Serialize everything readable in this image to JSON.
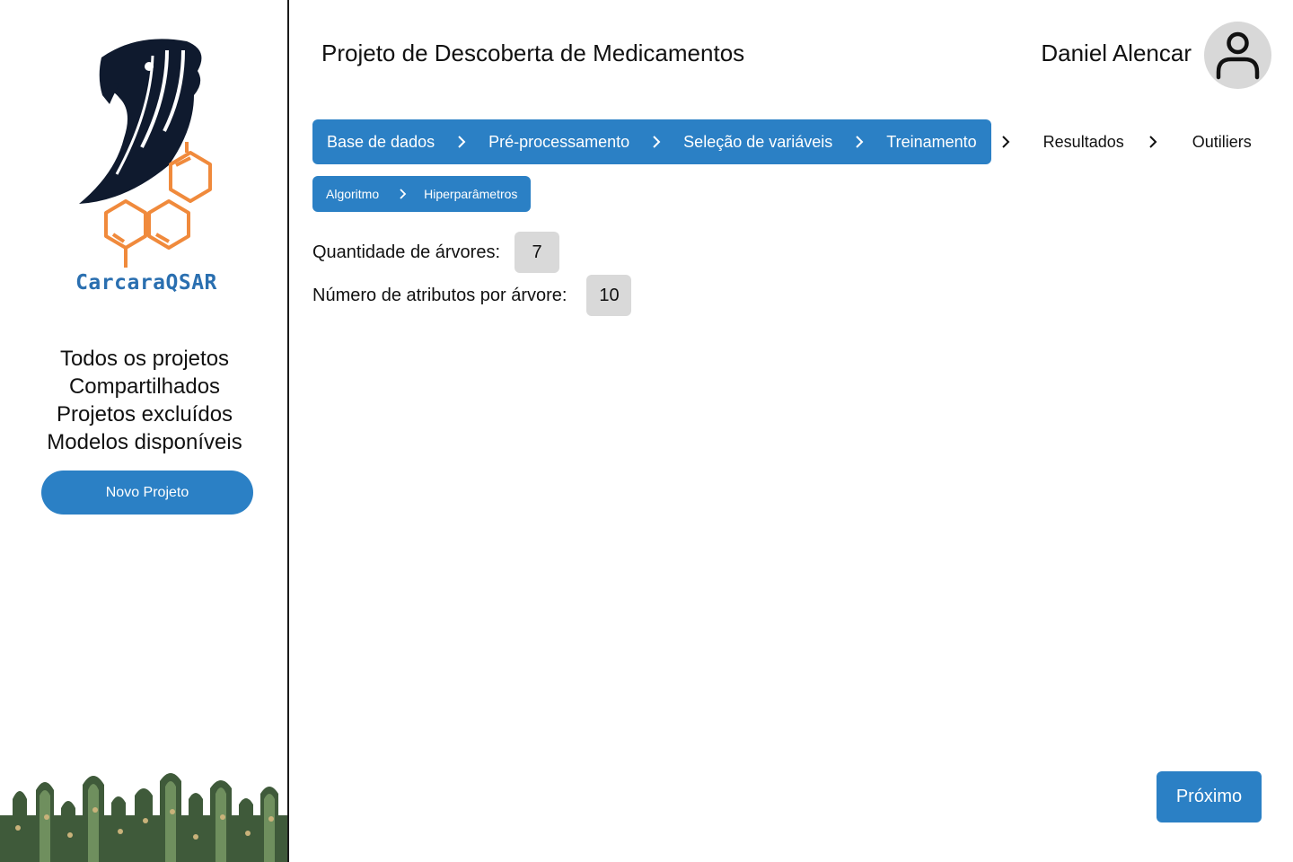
{
  "app": {
    "logo_text": "CarcaraQSAR",
    "colors": {
      "accent": "#2b80c5",
      "logo_orange": "#f08a3c",
      "logo_navy": "#0f1a2e",
      "logo_text": "#2a6fb0",
      "chip_bg": "#d9d9d9",
      "avatar_bg": "#d8d8d8"
    }
  },
  "sidebar": {
    "items": [
      {
        "label": "Todos os projetos"
      },
      {
        "label": "Compartilhados"
      },
      {
        "label": "Projetos excluídos"
      },
      {
        "label": "Modelos disponíveis"
      }
    ],
    "new_project_label": "Novo Projeto"
  },
  "header": {
    "title": "Projeto de Descoberta de Medicamentos",
    "user_name": "Daniel Alencar",
    "avatar_icon": "user-icon"
  },
  "steps": {
    "completed": [
      {
        "label": "Base de dados"
      },
      {
        "label": "Pré-processamento"
      },
      {
        "label": "Seleção de variáveis"
      },
      {
        "label": "Treinamento"
      }
    ],
    "upcoming": [
      {
        "label": "Resultados"
      },
      {
        "label": "Outiliers"
      }
    ],
    "separator_icon": "chevron-right-icon"
  },
  "substeps": [
    {
      "label": "Algoritmo"
    },
    {
      "label": "Hiperparâmetros"
    }
  ],
  "params": [
    {
      "label": "Quantidade de árvores:",
      "value": "7"
    },
    {
      "label": "Número de atributos por árvore:",
      "value": "10"
    }
  ],
  "footer": {
    "next_label": "Próximo"
  }
}
